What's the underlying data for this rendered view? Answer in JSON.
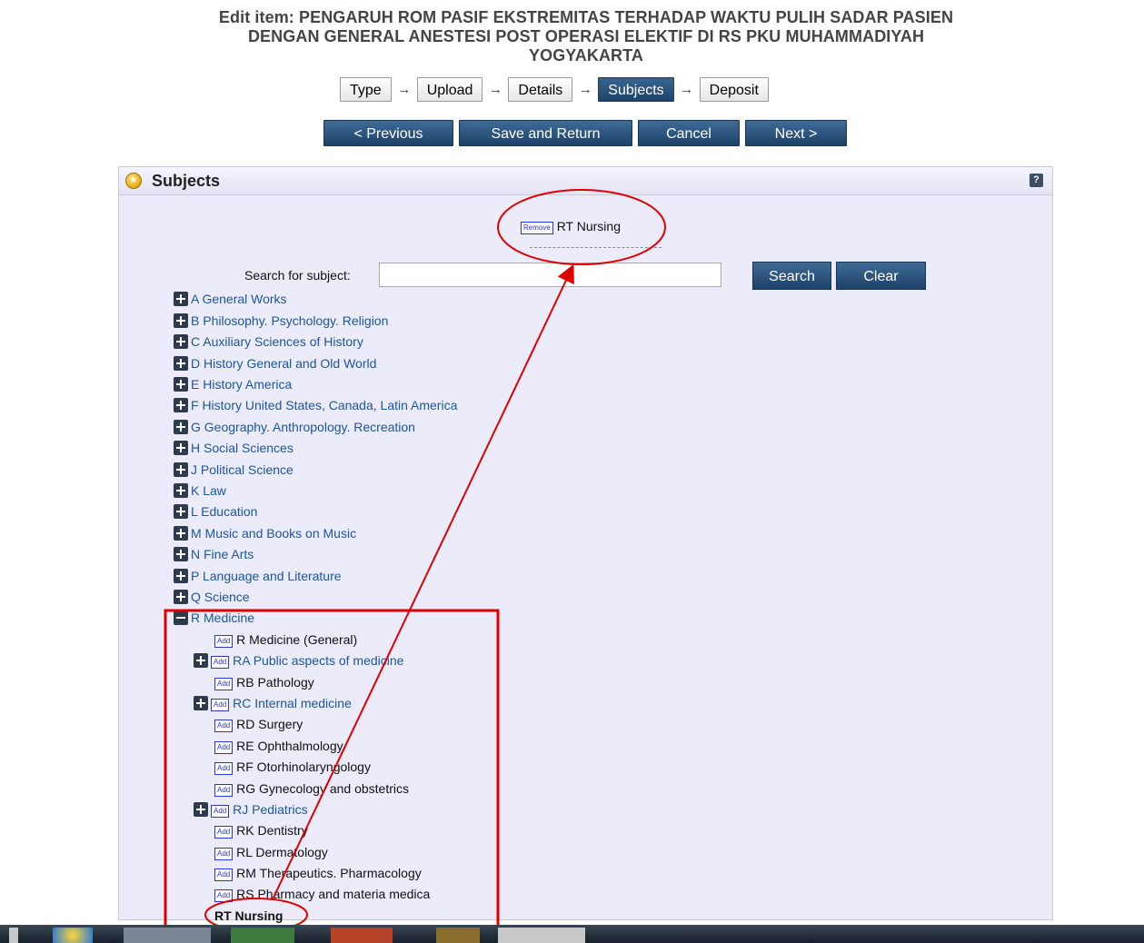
{
  "header": {
    "title_line1": "Edit item: PENGARUH ROM PASIF EKSTREMITAS TERHADAP WAKTU PULIH SADAR PASIEN",
    "title_line2": "DENGAN GENERAL  ANESTESI POST OPERASI ELEKTIF DI RS PKU MUHAMMADIYAH",
    "title_line3": "YOGYAKARTA"
  },
  "steps": [
    "Type",
    "Upload",
    "Details",
    "Subjects",
    "Deposit"
  ],
  "active_step": "Subjects",
  "nav": {
    "previous": "< Previous",
    "save": "Save and Return",
    "cancel": "Cancel",
    "next": "Next >"
  },
  "panel": {
    "title": "Subjects",
    "help": "?"
  },
  "selected_subject": {
    "remove_label": "Remove",
    "name": "RT Nursing"
  },
  "search": {
    "label": "Search for subject:",
    "value": "",
    "search_button": "Search",
    "clear_button": "Clear"
  },
  "subject_tree": [
    "A General Works",
    "B Philosophy. Psychology. Religion",
    "C Auxiliary Sciences of History",
    "D History General and Old World",
    "E History America",
    "F History United States, Canada, Latin America",
    "G Geography. Anthropology. Recreation",
    "H Social Sciences",
    "J Political Science",
    "K Law",
    "L Education",
    "M Music and Books on Music",
    "N Fine Arts",
    "P Language and Literature",
    "Q Science",
    "R Medicine"
  ],
  "medicine_children": [
    {
      "add": "Add",
      "label": "R Medicine (General)"
    },
    {
      "add": "Add",
      "label": "RA Public aspects of medicine"
    },
    {
      "add": "Add",
      "label": "RB Pathology"
    },
    {
      "add": "Add",
      "label": "RC Internal medicine"
    },
    {
      "add": "Add",
      "label": "RD Surgery"
    },
    {
      "add": "Add",
      "label": "RE Ophthalmology"
    },
    {
      "add": "Add",
      "label": "RF Otorhinolaryngology"
    },
    {
      "add": "Add",
      "label": "RG Gynecology and obstetrics"
    },
    {
      "add": "Add",
      "label": "RJ Pediatrics"
    },
    {
      "add": "Add",
      "label": "RK Dentistry"
    },
    {
      "add": "Add",
      "label": "RL Dermatology"
    },
    {
      "add": "Add",
      "label": "RM Therapeutics. Pharmacology"
    },
    {
      "add": "Add",
      "label": "RS Pharmacy and materia medica"
    },
    {
      "label": "RT Nursing"
    }
  ],
  "annotation_color": "#e00000"
}
